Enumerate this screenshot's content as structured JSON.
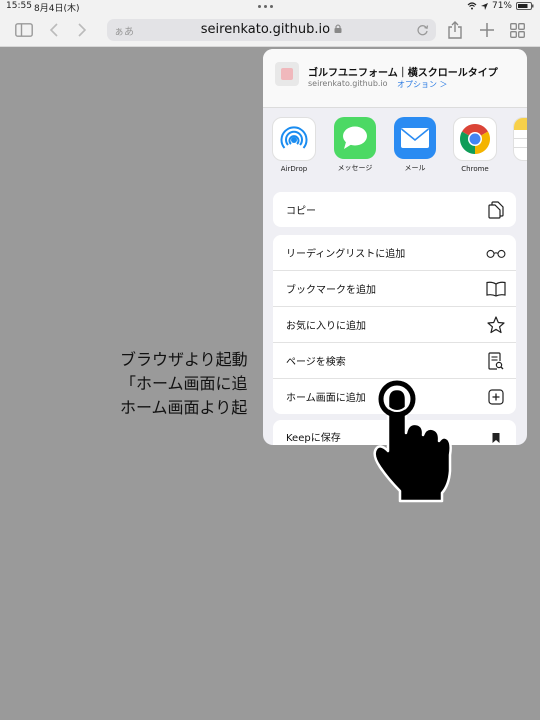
{
  "status": {
    "time": "15:55",
    "date": "8月4日(木)",
    "battery": "71%"
  },
  "toolbar": {
    "url_prefix": "ぁあ",
    "url": "seirenkato.github.io"
  },
  "background": {
    "lines": [
      "ブラウザより起動",
      "「ホーム画面に追",
      "ホーム画面より起"
    ]
  },
  "share": {
    "title": "ゴルフユニフォーム｜横スクロールタイプ",
    "domain": "seirenkato.github.io",
    "options": "オプション ＞",
    "apps": [
      {
        "label": "AirDrop",
        "icon": "airdrop-icon"
      },
      {
        "label": "メッセージ",
        "icon": "messages-icon"
      },
      {
        "label": "メール",
        "icon": "mail-icon"
      },
      {
        "label": "Chrome",
        "icon": "chrome-icon"
      },
      {
        "label": "",
        "icon": "notes-icon"
      }
    ],
    "copy": "コピー",
    "actions": [
      {
        "label": "リーディングリストに追加",
        "icon": "glasses-icon"
      },
      {
        "label": "ブックマークを追加",
        "icon": "book-icon"
      },
      {
        "label": "お気に入りに追加",
        "icon": "star-icon"
      },
      {
        "label": "ページを検索",
        "icon": "find-page-icon"
      },
      {
        "label": "ホーム画面に追加",
        "icon": "add-square-icon"
      }
    ],
    "keep": "Keepに保存"
  }
}
